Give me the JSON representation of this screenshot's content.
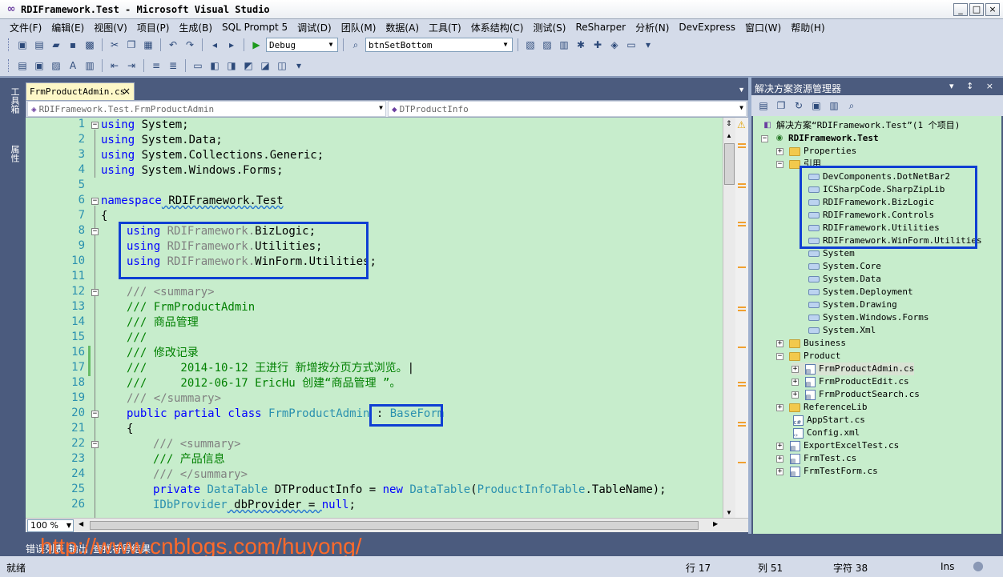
{
  "window": {
    "title": "RDIFramework.Test - Microsoft Visual Studio",
    "title_icon": "∞",
    "controls": [
      "_",
      "□",
      "×"
    ]
  },
  "menu": [
    "文件(F)",
    "编辑(E)",
    "视图(V)",
    "项目(P)",
    "生成(B)",
    "SQL Prompt 5",
    "调试(D)",
    "团队(M)",
    "数据(A)",
    "工具(T)",
    "体系结构(C)",
    "测试(S)",
    "ReSharper",
    "分析(N)",
    "DevExpress",
    "窗口(W)",
    "帮助(H)"
  ],
  "toolbar": {
    "config": "Debug",
    "find_target": "btnSetBottom"
  },
  "side_tabs": [
    "工具箱",
    "属性"
  ],
  "document": {
    "tab_label": "FrmProductAdmin.cs",
    "tab_close": "×",
    "nav_class": "RDIFramework.Test.FrmProductAdmin",
    "nav_member": "DTProductInfo"
  },
  "code": {
    "line_numbers": [
      "1",
      "2",
      "3",
      "4",
      "5",
      "6",
      "7",
      "8",
      "9",
      "10",
      "11",
      "12",
      "13",
      "14",
      "15",
      "16",
      "17",
      "18",
      "19",
      "20",
      "21",
      "22",
      "23",
      "24",
      "25",
      "26"
    ],
    "l1_kw": "using",
    "l1_rest": " System;",
    "l2_kw": "using",
    "l2_rest": " System.Data;",
    "l3_kw": "using",
    "l3_rest": " System.Collections.Generic;",
    "l4_kw": "using",
    "l4_rest": " System.Windows.Forms;",
    "l6_kw": "namespace",
    "l6_rest": " RDIFramework.Test",
    "l7": "{",
    "l8_kw": "using",
    "l8_gray": " RDIFramework.",
    "l8_rest": "BizLogic;",
    "l9_kw": "using",
    "l9_gray": " RDIFramework.",
    "l9_rest": "Utilities;",
    "l10_kw": "using",
    "l10_gray": " RDIFramework.",
    "l10_rest": "WinForm.Utilities;",
    "l12_c": "/// ",
    "l12_t": "<summary>",
    "l13": "/// FrmProductAdmin",
    "l14": "/// 商品管理",
    "l15": "///",
    "l16": "/// 修改记录",
    "l17": "///     2014-10-12 王进行 新增按分页方式浏览。",
    "l18": "///     2012-06-17 EricHu 创建“商品管理 ”。",
    "l19_c": "/// ",
    "l19_t": "</summary>",
    "l20_kw": "public partial class ",
    "l20_ty": "FrmProductAdmin",
    "l20_p": " : ",
    "l20_base": "BaseForm",
    "l21": "{",
    "l22_c": "/// ",
    "l22_t": "<summary>",
    "l23": "/// 产品信息",
    "l24_c": "/// ",
    "l24_t": "</summary>",
    "l25_kw": "private ",
    "l25_ty": "DataTable",
    "l25_p1": " DTProductInfo = ",
    "l25_kw2": "new ",
    "l25_ty2": "DataTable",
    "l25_p2": "(",
    "l25_ty3": "ProductInfoTable",
    "l25_p3": ".TableName);",
    "l26_ty": "IDbProvider",
    "l26_p": " dbProvider = ",
    "l26_kw": "null",
    "l26_end": ";"
  },
  "zoom": "100 %",
  "solution_explorer": {
    "title": "解决方案资源管理器",
    "header_controls": "▾ ↕ ×",
    "nodes": {
      "solution": "解决方案“RDIFramework.Test”(1 个项目)",
      "project": "RDIFramework.Test",
      "properties": "Properties",
      "references": "引用",
      "ref1": "DevComponents.DotNetBar2",
      "ref2": "ICSharpCode.SharpZipLib",
      "ref3": "RDIFramework.BizLogic",
      "ref4": "RDIFramework.Controls",
      "ref5": "RDIFramework.Utilities",
      "ref6": "RDIFramework.WinForm.Utilities",
      "ref7": "System",
      "ref8": "System.Core",
      "ref9": "System.Data",
      "ref10": "System.Deployment",
      "ref11": "System.Drawing",
      "ref12": "System.Windows.Forms",
      "ref13": "System.Xml",
      "business": "Business",
      "product": "Product",
      "p1": "FrmProductAdmin.cs",
      "p2": "FrmProductEdit.cs",
      "p3": "FrmProductSearch.cs",
      "reflib": "ReferenceLib",
      "appstart": "AppStart.cs",
      "config": "Config.xml",
      "export": "ExportExcelTest.cs",
      "frmtest": "FrmTest.cs",
      "frmtestform": "FrmTestForm.cs"
    }
  },
  "bottom": {
    "tab1": "错误列表",
    "tab2": "输出",
    "tab3": "查找符号结果",
    "watermark": "http://www.cnblogs.com/huyong/"
  },
  "status": {
    "ready": "就绪",
    "line": "行 17",
    "col": "列 51",
    "ch": "字符 38",
    "mode": "Ins"
  },
  "colors": {
    "code_bg": "#c7edcc",
    "chrome": "#4b5b7e",
    "highlight": "#0f3fd3",
    "watermark": "#ff6a2a"
  }
}
